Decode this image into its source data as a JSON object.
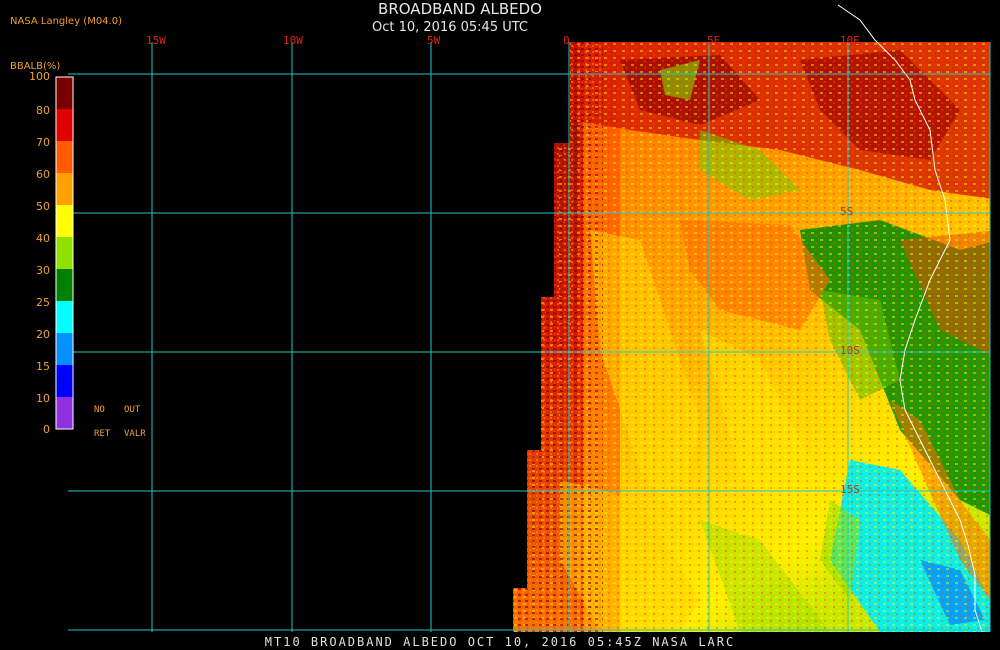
{
  "header": {
    "title": "BROADBAND ALBEDO",
    "subtitle": "Oct 10, 2016 05:45 UTC",
    "source": "NASA Langley (M04.0)"
  },
  "footer": {
    "text": "MT10  BROADBAND ALBEDO  OCT 10, 2016 05:45Z  NASA LARC"
  },
  "longitude_labels": [
    "15W",
    "10W",
    "5W",
    "0",
    "5E",
    "10E"
  ],
  "latitude_labels": [
    "5S",
    "10S",
    "15S"
  ],
  "legend": {
    "title": "BBALB(%)",
    "ticks": [
      "100",
      "80",
      "70",
      "60",
      "50",
      "40",
      "30",
      "25",
      "20",
      "15",
      "10",
      "0"
    ],
    "colors": [
      "#7a0000",
      "#e00000",
      "#ff5a00",
      "#ffa000",
      "#ffff00",
      "#90e000",
      "#008000",
      "#00ffff",
      "#0090ff",
      "#0000ff",
      "#9030e0"
    ],
    "no_ret_top": "NO",
    "no_ret_bottom": "RET",
    "out_valr_top": "OUT",
    "out_valr_bottom": "VALR"
  },
  "colors": {
    "grid": "#20c8c8",
    "coast": "#ffffff",
    "label_lon": "#e02020",
    "label_text": "#f0a030"
  }
}
